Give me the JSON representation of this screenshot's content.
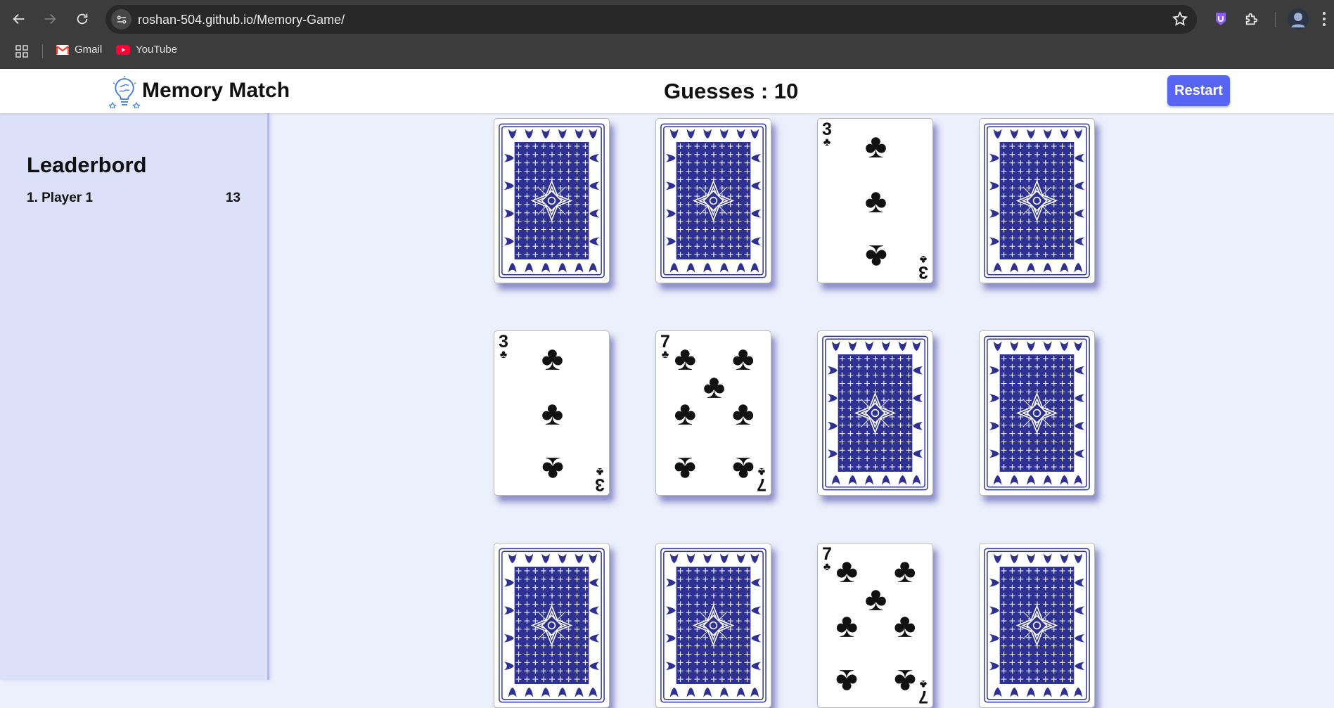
{
  "browser": {
    "url": "roshan-504.github.io/Memory-Game/",
    "bookmarks": [
      {
        "label": "Gmail",
        "icon": "gmail-icon"
      },
      {
        "label": "YouTube",
        "icon": "youtube-icon"
      }
    ]
  },
  "header": {
    "title": "Memory Match",
    "guesses_text": "Guesses : 10",
    "restart_label": "Restart"
  },
  "leaderboard": {
    "title": "Leaderbord",
    "entries": [
      {
        "name": "1. Player 1",
        "score": "13"
      }
    ]
  },
  "board": {
    "back_color": "#2e3192",
    "cards": [
      {
        "state": "back"
      },
      {
        "state": "back"
      },
      {
        "state": "face",
        "rank": "3",
        "suit": "♣"
      },
      {
        "state": "back"
      },
      {
        "state": "face",
        "rank": "3",
        "suit": "♣"
      },
      {
        "state": "face",
        "rank": "7",
        "suit": "♣"
      },
      {
        "state": "back"
      },
      {
        "state": "back"
      },
      {
        "state": "back"
      },
      {
        "state": "back"
      },
      {
        "state": "face",
        "rank": "7",
        "suit": "♣"
      },
      {
        "state": "back"
      }
    ]
  }
}
